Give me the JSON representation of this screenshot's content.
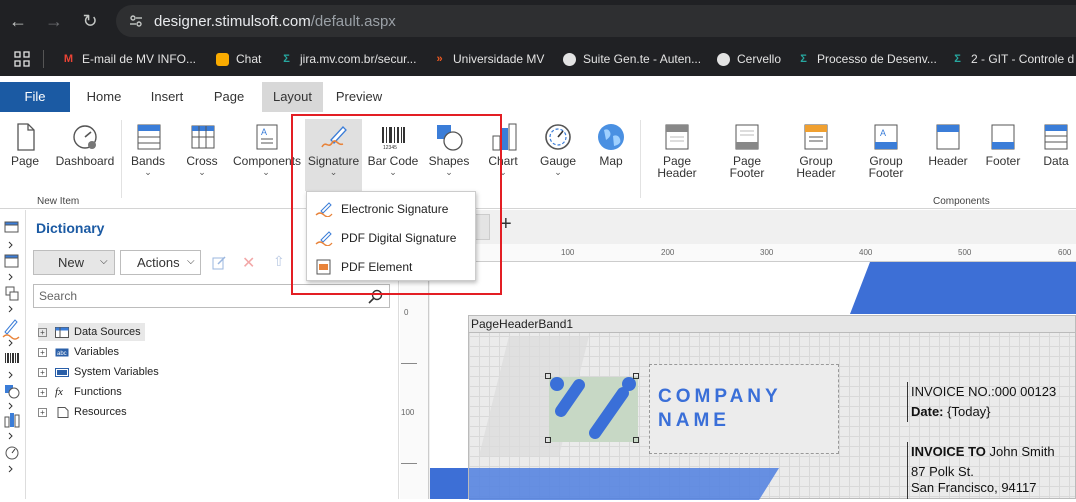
{
  "browser": {
    "url_host": "designer.stimulsoft.com",
    "url_path": "/default.aspx",
    "bookmarks": [
      {
        "label": "E-mail de MV INFO...",
        "icon": "gmail-icon"
      },
      {
        "label": "Chat",
        "icon": "chat-icon"
      },
      {
        "label": "jira.mv.com.br/secur...",
        "icon": "jira-icon"
      },
      {
        "label": "Universidade MV",
        "icon": "mv-icon"
      },
      {
        "label": "Suite Gen.te - Auten...",
        "icon": "globe-icon"
      },
      {
        "label": "Cervello",
        "icon": "globe-icon"
      },
      {
        "label": "Processo de Desenv...",
        "icon": "jira-icon"
      },
      {
        "label": "2 - GIT - Controle d",
        "icon": "jira-icon"
      }
    ]
  },
  "tabs": [
    "File",
    "Home",
    "Insert",
    "Page",
    "Layout",
    "Preview"
  ],
  "ribbon": {
    "new_item": [
      {
        "label": "Page"
      },
      {
        "label": "Dashboard"
      }
    ],
    "new_item_group": "New Item",
    "insert": [
      {
        "label": "Bands"
      },
      {
        "label": "Cross"
      },
      {
        "label": "Components"
      },
      {
        "label": "Signature"
      },
      {
        "label": "Bar Code"
      },
      {
        "label": "Shapes"
      },
      {
        "label": "Chart"
      },
      {
        "label": "Gauge"
      },
      {
        "label": "Map"
      }
    ],
    "components": [
      {
        "label": "Page\nHeader"
      },
      {
        "label": "Page\nFooter"
      },
      {
        "label": "Group\nHeader"
      },
      {
        "label": "Group\nFooter"
      },
      {
        "label": "Header"
      },
      {
        "label": "Footer"
      },
      {
        "label": "Data"
      }
    ],
    "components_group": "Components"
  },
  "signature_menu": [
    "Electronic Signature",
    "PDF Digital Signature",
    "PDF Element"
  ],
  "dictionary": {
    "title": "Dictionary",
    "new_label": "New",
    "actions_label": "Actions",
    "search_placeholder": "Search",
    "tree": [
      "Data Sources",
      "Variables",
      "System Variables",
      "Functions",
      "Resources"
    ]
  },
  "ruler": {
    "top": [
      "100",
      "200",
      "300",
      "400",
      "500",
      "600"
    ],
    "left": [
      "0",
      "100"
    ]
  },
  "report": {
    "band_title": "PageHeaderBand1",
    "company_line1": "COMPANY",
    "company_line2": "NAME",
    "invoice_no": "INVOICE NO.:000 00123",
    "date_label": "Date:",
    "date_value": "{Today}",
    "invoice_to_label": "INVOICE TO",
    "invoice_to_name": "John Smith",
    "address1": "87 Polk St.",
    "address2": "San Francisco, 94117"
  },
  "colors": {
    "accent": "#1b5aa3",
    "highlight": "#e31e24",
    "logo_blue": "#3a6fd8"
  }
}
